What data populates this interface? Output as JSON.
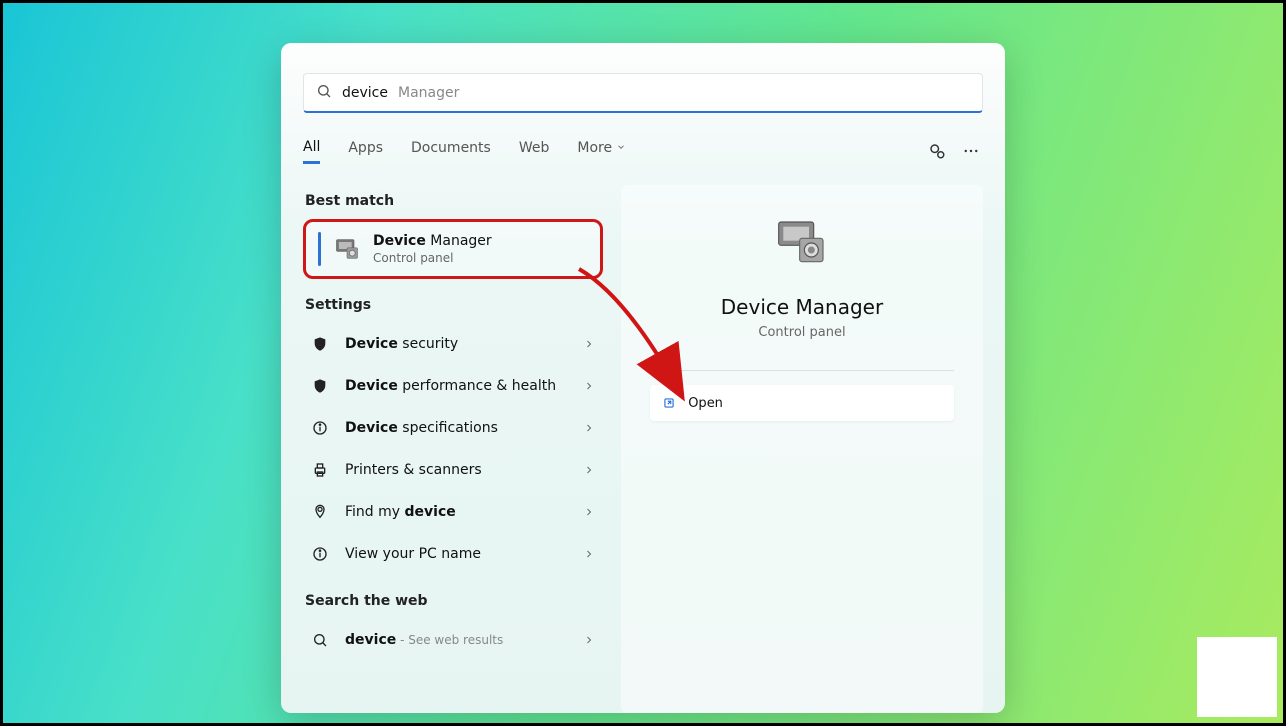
{
  "search": {
    "typed": "device",
    "suggestion": " Manager"
  },
  "tabs": {
    "items": [
      "All",
      "Apps",
      "Documents",
      "Web",
      "More"
    ],
    "active": 0
  },
  "sections": {
    "best_match": "Best match",
    "settings": "Settings",
    "search_web": "Search the web"
  },
  "best_match": {
    "title_bold": "Device",
    "title_rest": " Manager",
    "subtitle": "Control panel"
  },
  "settings_items": [
    {
      "bold": "Device",
      "rest": " security",
      "icon": "shield"
    },
    {
      "bold": "Device",
      "rest": " performance & health",
      "icon": "shield"
    },
    {
      "bold": "Device",
      "rest": " specifications",
      "icon": "info"
    },
    {
      "bold": "",
      "rest": "Printers & scanners",
      "icon": "printer"
    },
    {
      "bold": "",
      "rest_pre": "Find my ",
      "bold2": "device",
      "icon": "location"
    },
    {
      "bold": "",
      "rest": "View your PC name",
      "icon": "info"
    }
  ],
  "web_item": {
    "bold": "device",
    "dim": " - See web results"
  },
  "preview": {
    "title": "Device Manager",
    "subtitle": "Control panel",
    "action": "Open"
  },
  "annotations": {
    "highlight_color": "#cf1717",
    "arrow_color": "#d01515"
  }
}
